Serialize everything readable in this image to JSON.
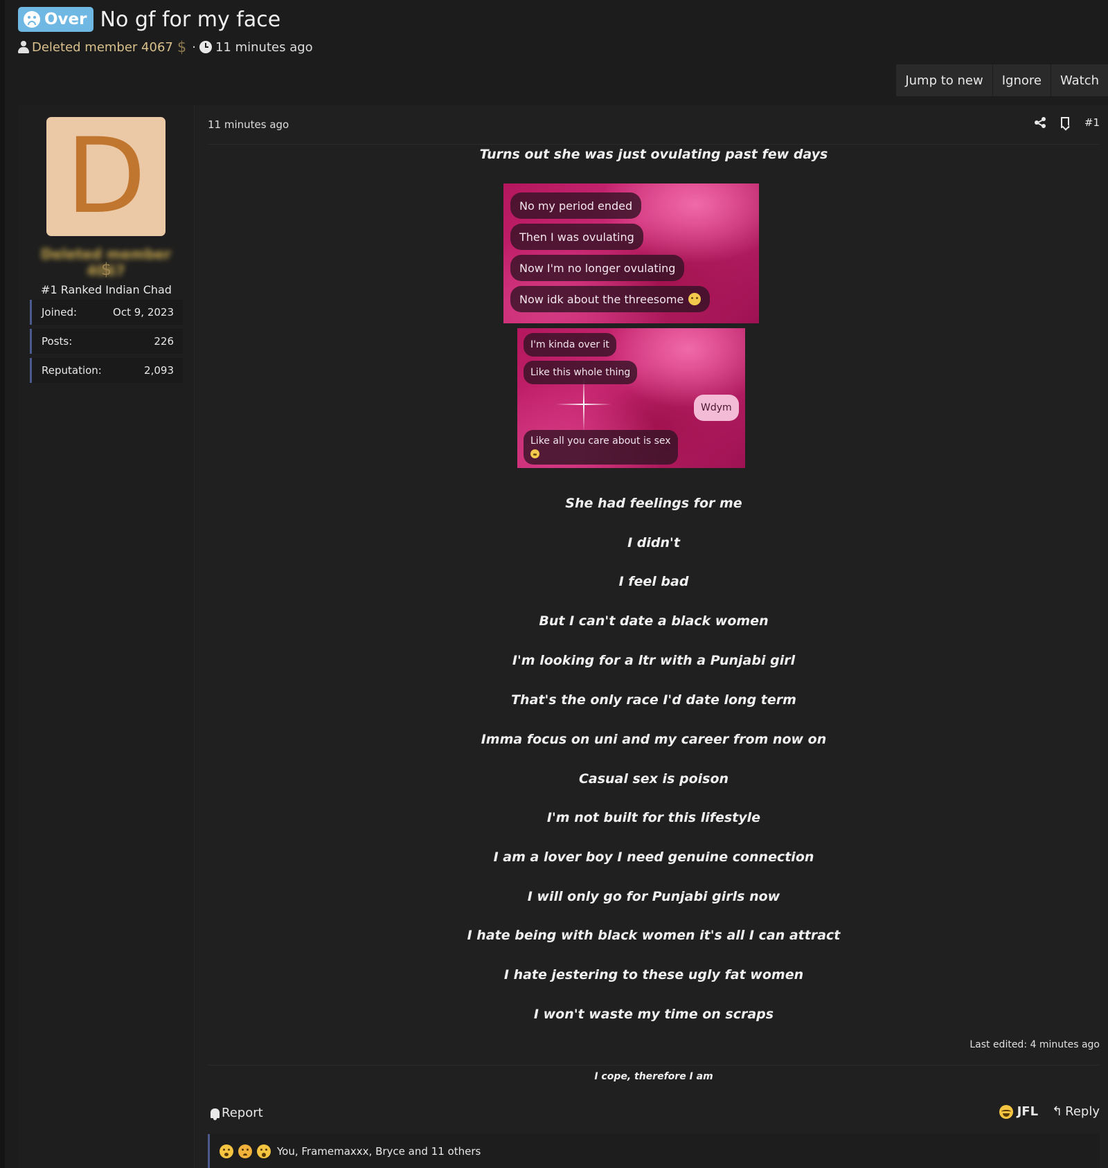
{
  "thread": {
    "prefix": "Over",
    "title": "No gf for my face",
    "author": "Deleted member 4067",
    "author_badge": "$",
    "time": "11 minutes ago",
    "actions": [
      "Jump to new",
      "Ignore",
      "Watch"
    ]
  },
  "user": {
    "avatar_letter": "D",
    "name": "Deleted member 4067",
    "badge": "$",
    "title": "#1 Ranked Indian Chad",
    "stats": [
      {
        "label": "Joined:",
        "value": "Oct 9, 2023"
      },
      {
        "label": "Posts:",
        "value": "226"
      },
      {
        "label": "Reputation:",
        "value": "2,093"
      }
    ]
  },
  "post": {
    "time": "11 minutes ago",
    "number": "#1",
    "intro": "Turns out she was just ovulating past few days",
    "screenshot1": [
      "No my period ended",
      "Then I was ovulating",
      "Now I'm no longer ovulating",
      "Now idk about the threesome"
    ],
    "screenshot2": {
      "left": [
        "I'm kinda over it",
        "Like this whole thing",
        "Like all you care about is sex"
      ],
      "right": "Wdym"
    },
    "lines": [
      "She had feelings for me",
      "I didn't",
      "I feel bad",
      "But I can't date a black women",
      "I'm looking for a ltr with a Punjabi girl",
      "That's the only race I'd date long term",
      "Imma focus on uni and my career from now on",
      "Casual sex is poison",
      "I'm not built for this lifestyle",
      "I am a lover boy I need genuine connection",
      "I will only go for Punjabi girls now",
      "I hate being with black women it's all I can attract",
      "I hate jestering to these ugly fat women",
      "I won't waste my time on scraps"
    ],
    "last_edited": "Last edited: 4 minutes ago",
    "signature": "I cope, therefore I am"
  },
  "footer": {
    "report": "Report",
    "jfl": "JFL",
    "reply": "Reply",
    "reply_icon": "reply-arrow-icon",
    "reactions_text": "You, Framemaxxx, Bryce and 11 others"
  },
  "colors": {
    "background": "#1c1c1c",
    "prefix_badge": "#6fb8e3",
    "author_name": "#d9c08c",
    "avatar_bg": "#ecc9a6",
    "avatar_letter": "#c0762f",
    "stat_border": "#4a5a8c"
  }
}
